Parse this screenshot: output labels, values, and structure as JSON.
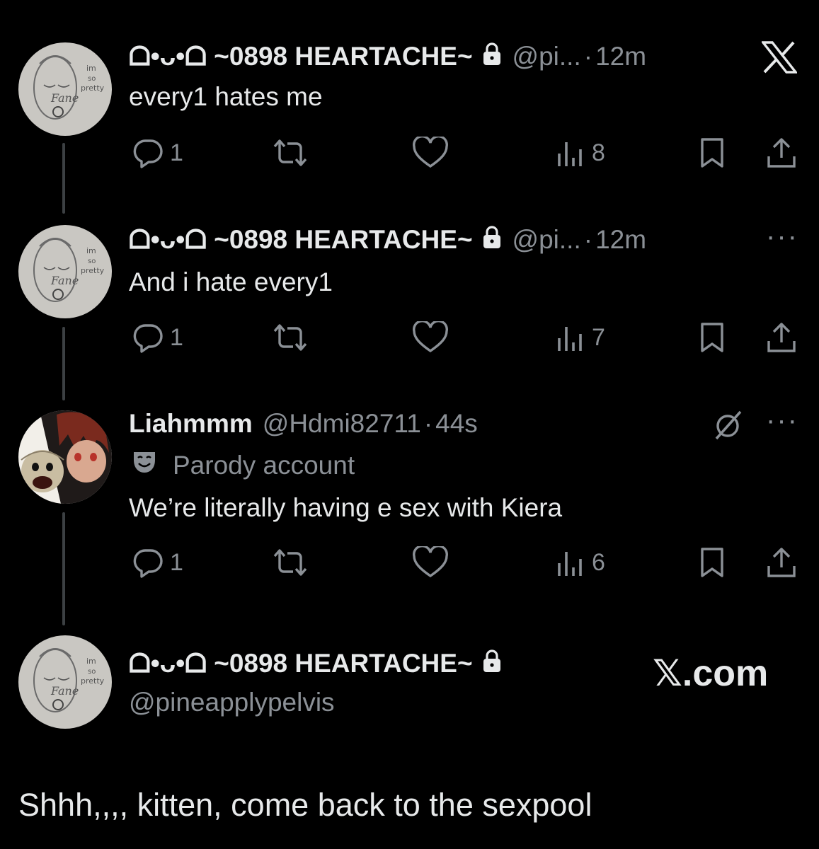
{
  "tweets": [
    {
      "name": "ᗝ•ᴗ•ᗝ ~0898 HEARTACHE~",
      "handle": "@pi...",
      "separator": "·",
      "time": "12m",
      "text": "every1 hates me",
      "replies": "1",
      "views": "8",
      "avatar_doodle_text": [
        "im",
        "so",
        "pretty"
      ]
    },
    {
      "name": "ᗝ•ᴗ•ᗝ ~0898 HEARTACHE~",
      "handle": "@pi...",
      "separator": "·",
      "time": "12m",
      "text": "And i hate every1",
      "replies": "1",
      "views": "7",
      "avatar_doodle_text": [
        "im",
        "so",
        "pretty"
      ]
    },
    {
      "name": "Liahmmm",
      "handle": "@Hdmi82711",
      "separator": "·",
      "time": "44s",
      "badge": "Parody account",
      "text": "We’re literally having e sex with Kiera",
      "replies": "1",
      "views": "6"
    }
  ],
  "profile": {
    "name": "ᗝ•ᴗ•ᗝ ~0898 HEARTACHE~",
    "handle": "@pineapplypelvis",
    "watermark": "𝕏.com",
    "avatar_doodle_text": [
      "im",
      "so",
      "pretty"
    ]
  },
  "caption": "Shhh,,,, kitten, come back to the sexpool",
  "icons": {
    "x_logo": "x-logo-icon",
    "lock": "lock-icon",
    "more": "more-dots-icon",
    "reply": "reply-icon",
    "retweet": "retweet-icon",
    "like": "heart-icon",
    "views": "views-icon",
    "bookmark": "bookmark-icon",
    "share": "share-icon",
    "parody": "parody-mask-icon",
    "grok": "grok-icon"
  },
  "colors": {
    "background": "#000000",
    "text": "#e7e9ea",
    "muted": "#8b9096",
    "thread_line": "#3c4043"
  }
}
